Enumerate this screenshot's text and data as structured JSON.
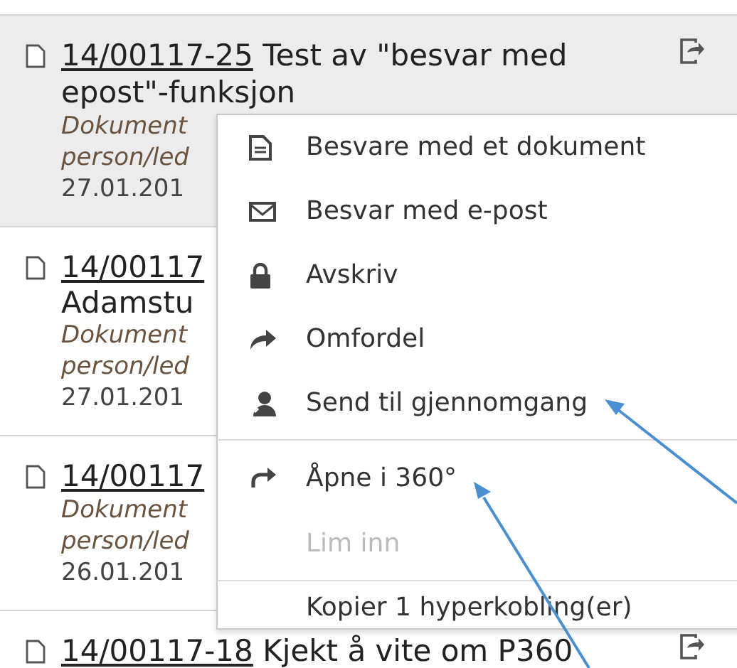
{
  "documents": [
    {
      "highlighted": true,
      "share": true,
      "lines": [
        {
          "kind": "heading",
          "number": "14/00117-25",
          "title": "Test av \"besvar med epost\"-funksjon"
        },
        {
          "kind": "meta",
          "text": "Dokument"
        },
        {
          "kind": "meta",
          "text": "person/led"
        },
        {
          "kind": "date",
          "text": "27.01.201"
        }
      ]
    },
    {
      "highlighted": false,
      "share": false,
      "lines": [
        {
          "kind": "heading",
          "number": "14/00117"
        },
        {
          "kind": "text",
          "text": "Adamstu"
        },
        {
          "kind": "meta",
          "text": "Dokument"
        },
        {
          "kind": "meta",
          "text": "person/led"
        },
        {
          "kind": "date",
          "text": "27.01.201"
        }
      ]
    },
    {
      "highlighted": false,
      "share": false,
      "lines": [
        {
          "kind": "heading",
          "number": "14/00117"
        },
        {
          "kind": "meta",
          "text": "Dokument"
        },
        {
          "kind": "meta",
          "text": "person/led"
        },
        {
          "kind": "date",
          "text": "26.01.201"
        }
      ]
    },
    {
      "highlighted": false,
      "share": true,
      "lines": [
        {
          "kind": "heading",
          "number": "14/00117-18",
          "title": "Kjekt å vite om P360"
        }
      ]
    }
  ],
  "context_menu": [
    {
      "kind": "item",
      "label": "Besvare med et dokument",
      "disabled": false
    },
    {
      "kind": "item",
      "label": "Besvar med e-post",
      "disabled": false
    },
    {
      "kind": "item",
      "label": "Avskriv",
      "disabled": false
    },
    {
      "kind": "item",
      "label": "Omfordel",
      "disabled": false
    },
    {
      "kind": "item",
      "label": "Send til gjennomgang",
      "disabled": false
    },
    {
      "kind": "separator"
    },
    {
      "kind": "item",
      "label": "Åpne i 360°",
      "disabled": false
    },
    {
      "kind": "item",
      "label": "Lim inn",
      "disabled": true
    },
    {
      "kind": "separator"
    },
    {
      "kind": "item",
      "label": "Kopier 1 hyperkobling(er)",
      "disabled": false
    }
  ]
}
